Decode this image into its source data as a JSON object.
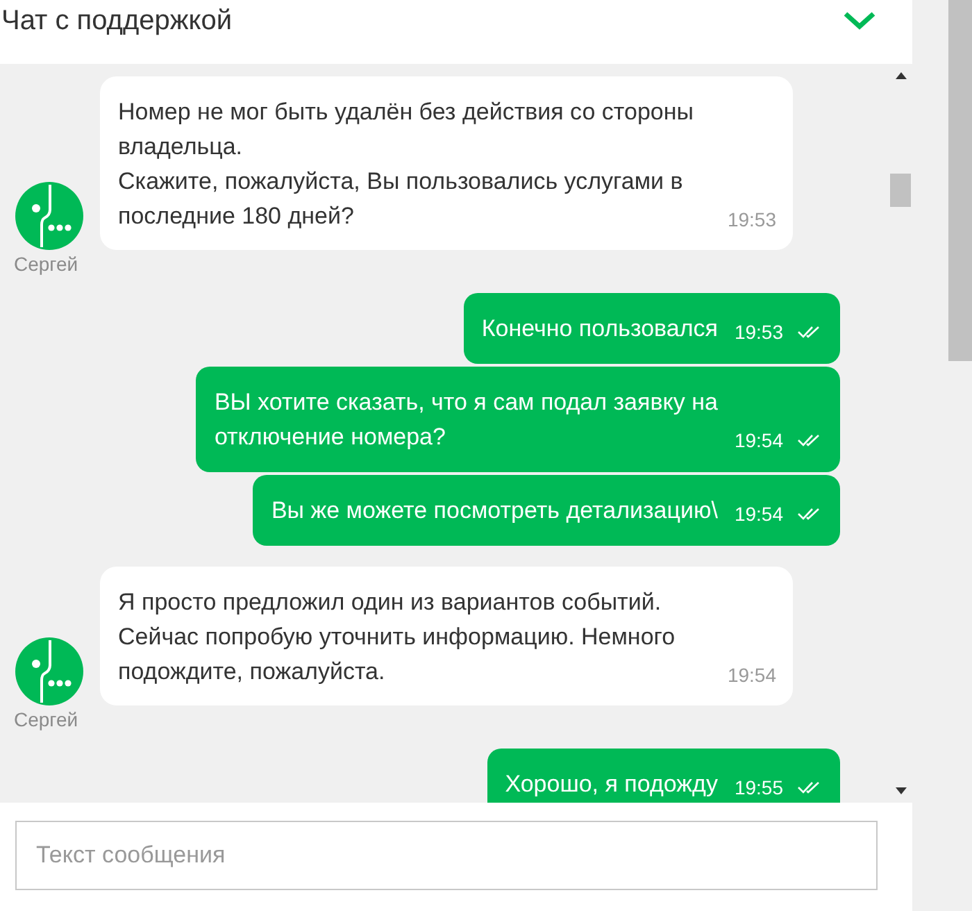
{
  "header": {
    "title": "Чат с поддержкой"
  },
  "messages": [
    {
      "kind": "incoming",
      "text": "Номер не мог быть удалён без действия со стороны\nвладельца.\nСкажите, пожалуйста, Вы пользовались услугами в\nпоследние 180 дней?",
      "time": "19:53",
      "sender": "Сергей"
    },
    {
      "kind": "outgoing",
      "text": "Конечно пользовался",
      "time": "19:53"
    },
    {
      "kind": "outgoing",
      "text": "ВЫ хотите сказать, что я сам подал заявку на\nотключение номера?",
      "time": "19:54"
    },
    {
      "kind": "outgoing",
      "text": "Вы же можете посмотреть детализацию\\",
      "time": "19:54"
    },
    {
      "kind": "incoming",
      "text": "Я просто предложил один из вариантов событий.\nСейчас попробую уточнить информацию. Немного\nподождите, пожалуйста.",
      "time": "19:54",
      "sender": "Сергей"
    },
    {
      "kind": "outgoing",
      "text": "Хорошо, я подожду",
      "time": "19:55"
    }
  ],
  "composer": {
    "placeholder": "Текст сообщения"
  }
}
